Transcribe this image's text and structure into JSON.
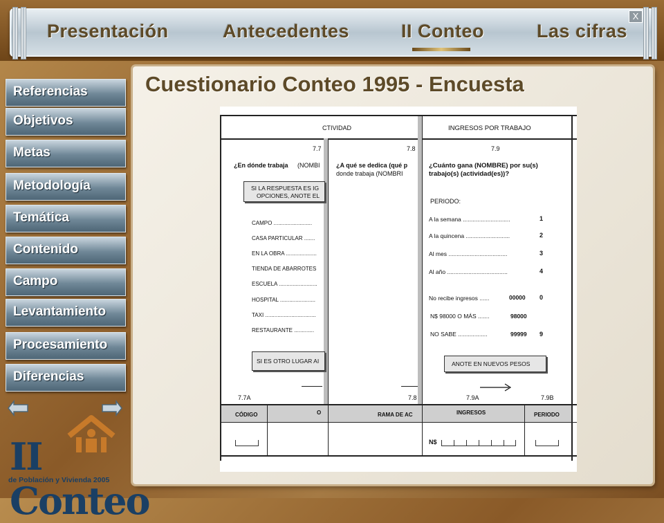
{
  "nav": {
    "items": [
      "Presentación",
      "Antecedentes",
      "II Conteo",
      "Las cifras"
    ],
    "active_index": 2,
    "close_label": "X"
  },
  "sidebar": {
    "items": [
      "Referencias",
      "Objetivos",
      "Metas",
      "Metodología",
      "Temática",
      "Contenido",
      "Campo",
      "Levantamiento",
      "Procesamiento",
      "Diferencias"
    ]
  },
  "arrows": {
    "prev": "previous-arrow-icon",
    "next": "next-arrow-icon"
  },
  "logo": {
    "title": "II Conteo",
    "subtitle": "de Población y Vivienda 2005"
  },
  "page_title": "Cuestionario Conteo 1995 - Encuesta",
  "questionnaire": {
    "headers": {
      "actividad": "CTIVIDAD",
      "ingresos": "INGRESOS POR TRABAJO"
    },
    "q77": {
      "num": "7.7",
      "question_bold": "¿En dónde trabaja",
      "question_rest": "(NOMBI",
      "instruction": [
        "SI LA RESPUESTA ES IG",
        "OPCIONES, ANOTE EL"
      ],
      "options": [
        "CAMPO .........................",
        "CASA PARTICULAR .......",
        "EN LA OBRA ....................",
        "TIENDA DE ABARROTES",
        "ESCUELA .........................",
        "HOSPITAL .......................",
        "TAXI .................................",
        "RESTAURANTE ............."
      ],
      "other": "SI ES OTRO LUGAR AI"
    },
    "q78": {
      "num": "7.8",
      "question_bold": "¿A qué se dedica (qué p",
      "question_rest": "donde trabaja (NOMBRI"
    },
    "q79": {
      "num": "7.9",
      "question": "¿Cuánto gana (NOMBRE) por su(s) trabajo(s) (actividad(es))?",
      "periodo_label": "PERIODO:",
      "periods": [
        {
          "label": "A la semana .............................",
          "code": "1"
        },
        {
          "label": "A la quincena ...........................",
          "code": "2"
        },
        {
          "label": "Al mes ....................................",
          "code": "3"
        },
        {
          "label": "Al año .....................................",
          "code": "4"
        }
      ],
      "special": [
        {
          "label": "No recibe ingresos ......",
          "value": "00000",
          "code": "0"
        },
        {
          "label": "N$ 98000 O MÁS .......",
          "value": "98000",
          "code": ""
        },
        {
          "label": "NO SABE ..................",
          "value": "99999",
          "code": "9"
        }
      ],
      "note": "ANOTE EN NUEVOS PESOS"
    },
    "footer": {
      "codes": [
        "7.7A",
        "7.8",
        "7.9A",
        "7.9B"
      ],
      "cols": [
        "CÓDIGO",
        "O",
        "RAMA DE AC",
        "INGRESOS",
        "PERIODO"
      ],
      "currency": "N$"
    }
  }
}
